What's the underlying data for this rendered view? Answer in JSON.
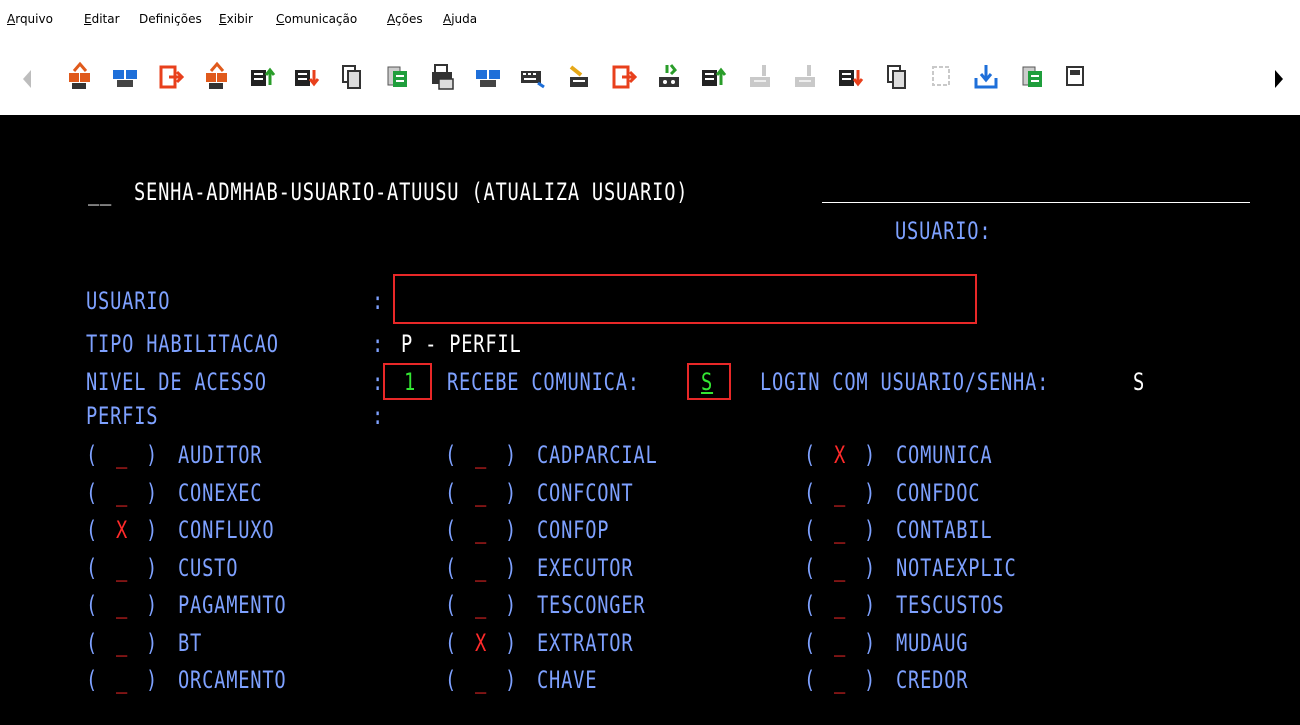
{
  "menu": {
    "items": [
      "Arquivo",
      "Editar",
      "Definições",
      "Exibir",
      "Comunicação",
      "Ações",
      "Ajuda"
    ]
  },
  "toolbar": {
    "icons": [
      "send-orange-icon",
      "connect-blue-icon",
      "exit-red-icon",
      "send-orange-icon",
      "upload-icon",
      "download-icon",
      "copy-icon",
      "green-doc-icon",
      "print-icon",
      "connect-blue-icon",
      "keyboard-icon",
      "brush-icon",
      "exit-red-icon",
      "receive-icon",
      "upload-icon",
      "disabled-icon",
      "disabled-icon",
      "download-icon",
      "copy-icon",
      "refresh-disabled-icon",
      "save-down-icon",
      "green-doc-icon",
      "macro-icon"
    ]
  },
  "screen": {
    "title": "SENHA-ADMHAB-USUARIO-ATUUSU (ATUALIZA USUARIO)",
    "title_prefix": "__",
    "usuario_header_label": "USUARIO:",
    "fields": {
      "usuario_label": "USUARIO",
      "usuario_value": "",
      "tipo_label": "TIPO HABILITACAO",
      "tipo_value": "P - PERFIL",
      "nivel_label": "NIVEL DE ACESSO",
      "nivel_value": "1",
      "recebe_label": "RECEBE COMUNICA:",
      "recebe_value": "S",
      "login_label": "LOGIN COM USUARIO/SENHA:",
      "login_value": "S",
      "perfis_label": "PERFIS"
    },
    "sep": ":",
    "perfis": [
      [
        {
          "mark": "_",
          "name": "AUDITOR"
        },
        {
          "mark": "_",
          "name": "CADPARCIAL"
        },
        {
          "mark": "X",
          "name": "COMUNICA"
        }
      ],
      [
        {
          "mark": "_",
          "name": "CONEXEC"
        },
        {
          "mark": "_",
          "name": "CONFCONT"
        },
        {
          "mark": "_",
          "name": "CONFDOC"
        }
      ],
      [
        {
          "mark": "X",
          "name": "CONFLUXO"
        },
        {
          "mark": "_",
          "name": "CONFOP"
        },
        {
          "mark": "_",
          "name": "CONTABIL"
        }
      ],
      [
        {
          "mark": "_",
          "name": "CUSTO"
        },
        {
          "mark": "_",
          "name": "EXECUTOR"
        },
        {
          "mark": "_",
          "name": "NOTAEXPLIC"
        }
      ],
      [
        {
          "mark": "_",
          "name": "PAGAMENTO"
        },
        {
          "mark": "_",
          "name": "TESCONGER"
        },
        {
          "mark": "_",
          "name": "TESCUSTOS"
        }
      ],
      [
        {
          "mark": "_",
          "name": "BT"
        },
        {
          "mark": "X",
          "name": "EXTRATOR"
        },
        {
          "mark": "_",
          "name": "MUDAUG"
        }
      ],
      [
        {
          "mark": "_",
          "name": "ORCAMENTO"
        },
        {
          "mark": "_",
          "name": "CHAVE"
        },
        {
          "mark": "_",
          "name": "CREDOR"
        }
      ]
    ]
  },
  "colors": {
    "background": "#000000",
    "label": "#7ea1ff",
    "value": "#ffffff",
    "input": "#33e633",
    "mark": "#ff2a2a",
    "highlight_box": "#e82828"
  }
}
